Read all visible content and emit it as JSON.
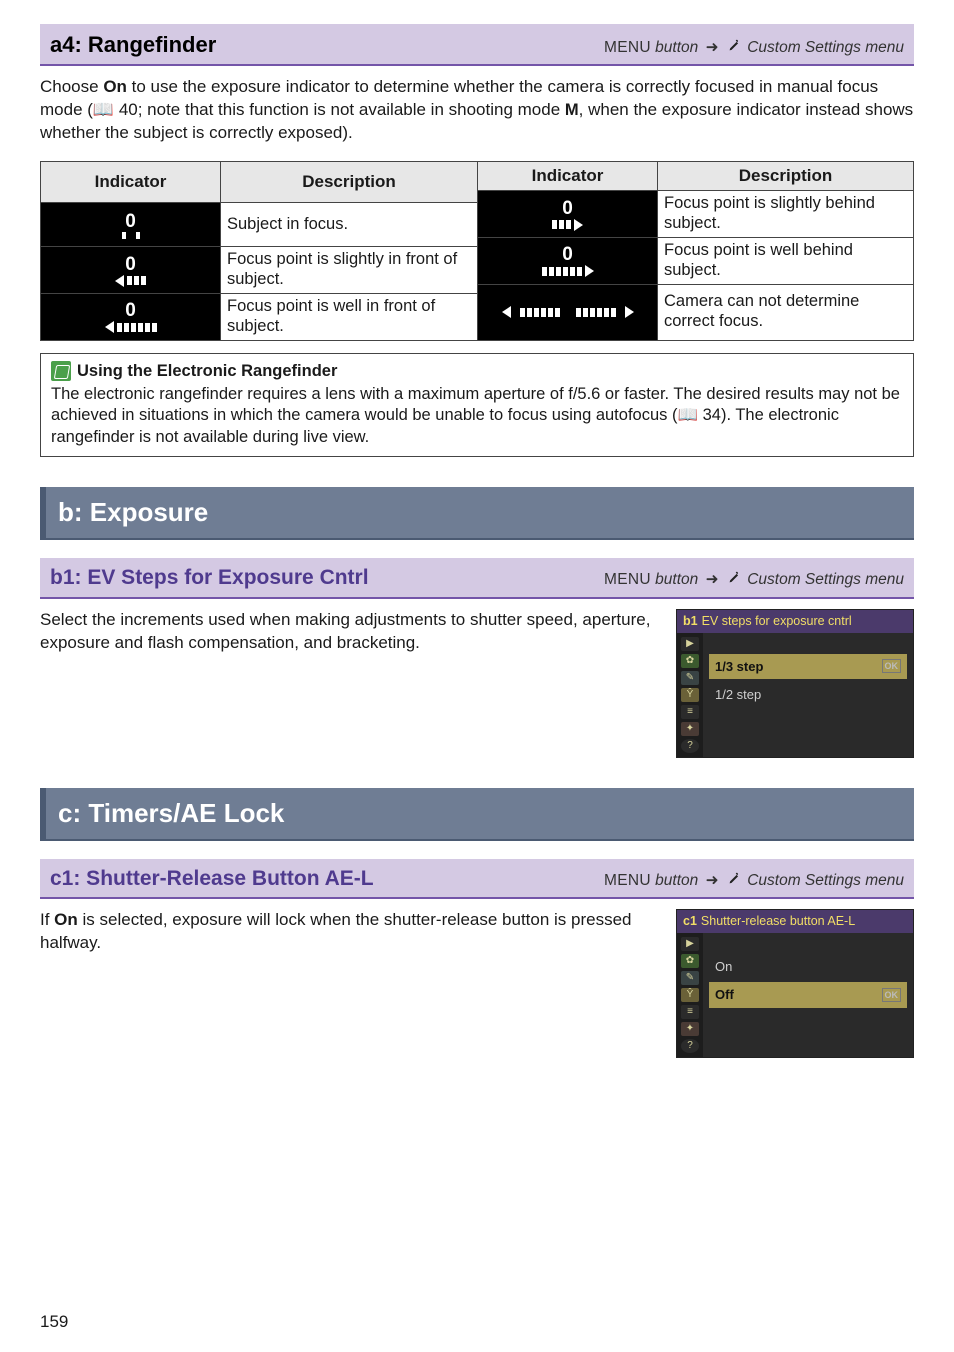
{
  "sections": {
    "a4": {
      "title": "a4: Rangefinder",
      "menu_button": "MENU",
      "button_word": "button",
      "trail": "Custom Settings menu",
      "paragraph_parts": {
        "p1a": "Choose ",
        "p1b": "On",
        "p1c": " to use the exposure indicator to determine whether the camera is correctly focused in manual focus mode (",
        "p1d": " 40; note that this function is not available in shooting mode ",
        "p1e": "M",
        "p1f": ", when the exposure indicator instead shows whether the subject is correctly exposed)."
      },
      "table": {
        "col_indicator": "Indicator",
        "col_description": "Description",
        "rows_left": [
          {
            "desc": "Subject in focus."
          },
          {
            "desc": "Focus point is slightly in front of subject."
          },
          {
            "desc": "Focus point is well in front of subject."
          }
        ],
        "rows_right": [
          {
            "desc": "Focus point is slightly behind subject."
          },
          {
            "desc": "Focus point is well behind subject."
          },
          {
            "desc": "Camera can not determine correct focus."
          }
        ]
      },
      "callout": {
        "title": "Using the Electronic Rangefinder",
        "body_a": "The electronic rangefinder requires a lens with a maximum aperture of f/5.6 or faster.  The desired results may not be achieved in situations in which the camera would be unable to focus using autofocus (",
        "body_b": " 34).  The electronic rangefinder is not available during live view."
      }
    },
    "b": {
      "heading": "b: Exposure",
      "b1": {
        "title": "b1: EV Steps for Exposure Cntrl",
        "menu_button": "MENU",
        "button_word": "button",
        "trail": "Custom Settings menu",
        "paragraph": "Select the increments used when making adjustments to shutter speed, aperture, exposure and flash compensation, and bracketing.",
        "cam": {
          "top_pre": "b1",
          "top_title": "EV steps for exposure cntrl",
          "items": [
            "1/3 step",
            "1/2 step"
          ],
          "selected_index": 0,
          "ok": "OK"
        }
      }
    },
    "c": {
      "heading": "c: Timers/AE Lock",
      "c1": {
        "title": "c1: Shutter-Release Button AE-L",
        "menu_button": "MENU",
        "button_word": "button",
        "trail": "Custom Settings menu",
        "paragraph_parts": {
          "a": "If ",
          "b": "On",
          "c": " is selected, exposure will lock when the shutter-release button is pressed halfway."
        },
        "cam": {
          "top_pre": "c1",
          "top_title": "Shutter-release button AE-L",
          "items": [
            "On",
            "Off"
          ],
          "selected_index": 1,
          "ok": "OK"
        }
      }
    }
  },
  "page_number": "159"
}
